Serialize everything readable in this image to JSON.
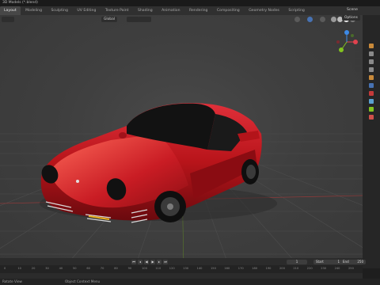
{
  "window": {
    "title": "3D Models (*.blend)"
  },
  "workspace_tabs": [
    "Layout",
    "Modeling",
    "Sculpting",
    "UV Editing",
    "Texture Paint",
    "Shading",
    "Animation",
    "Rendering",
    "Compositing",
    "Geometry Nodes",
    "Scripting"
  ],
  "active_tab": "Layout",
  "scene": {
    "label": "Scene"
  },
  "viewport_header": {
    "orientation_label": "Global",
    "options_label": "Options"
  },
  "timeline": {
    "start_label": "Start",
    "start_value": "1",
    "end_label": "End",
    "end_value": "250",
    "current_frame": "1",
    "ruler_ticks": [
      "0",
      "10",
      "20",
      "30",
      "40",
      "50",
      "60",
      "70",
      "80",
      "90",
      "100",
      "110",
      "120",
      "130",
      "140",
      "150",
      "160",
      "170",
      "180",
      "190",
      "200",
      "210",
      "220",
      "230",
      "240",
      "250"
    ]
  },
  "status_bar": {
    "left_hint": "Rotate View",
    "middle_hint": "Object Context Menu"
  },
  "colors": {
    "car_body": "#b8141a",
    "car_highlight": "#ff6a5a",
    "gizmo_x": "#e0424e",
    "gizmo_y": "#83c31f",
    "gizmo_z": "#3d8ae8",
    "accent": "#4772b3"
  }
}
